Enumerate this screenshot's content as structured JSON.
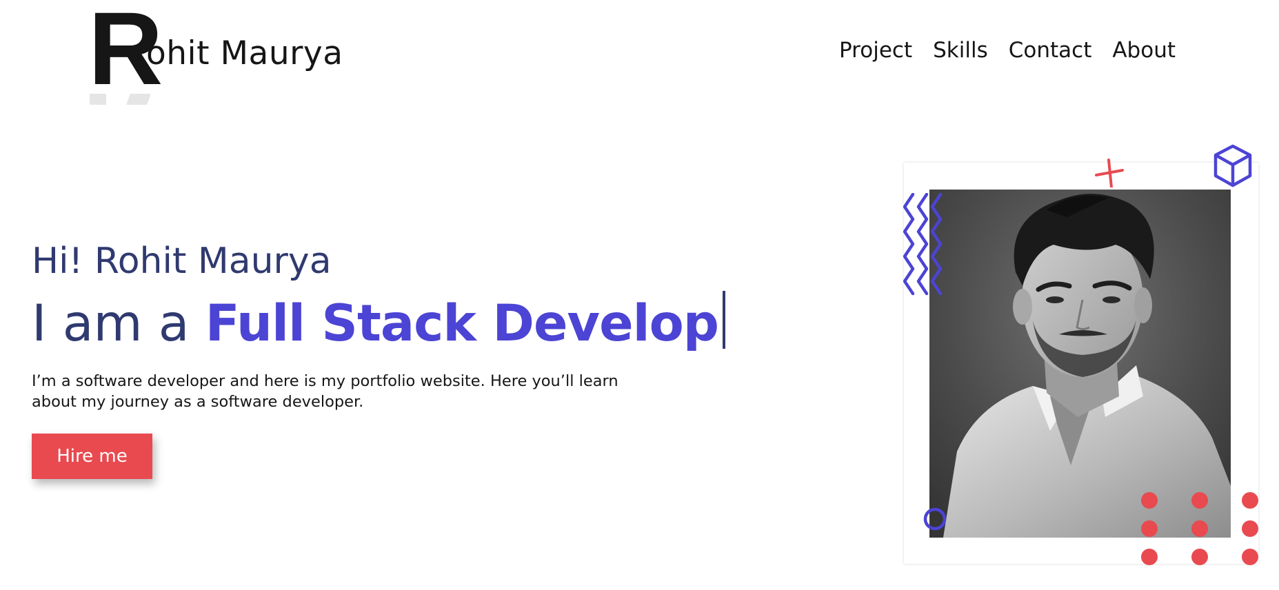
{
  "header": {
    "logo_initial": "R",
    "logo_rest": "ohit Maurya",
    "nav": [
      "Project",
      "Skills",
      "Contact",
      "About"
    ]
  },
  "hero": {
    "greeting": "Hi! Rohit Maurya",
    "headline_prefix": "I am a",
    "headline_role": "Full Stack Develop",
    "intro": "I’m a software developer and here is my portfolio website. Here you’ll learn about my journey as a software developer.",
    "cta_label": "Hire me"
  },
  "colors": {
    "accent_purple": "#4c44d4",
    "accent_red": "#e84a4f",
    "heading_navy": "#303a70",
    "text_dark": "#161616"
  },
  "icons": [
    "plus-icon",
    "cube-icon",
    "zigzag-icon",
    "circle-icon",
    "dots-pattern"
  ]
}
